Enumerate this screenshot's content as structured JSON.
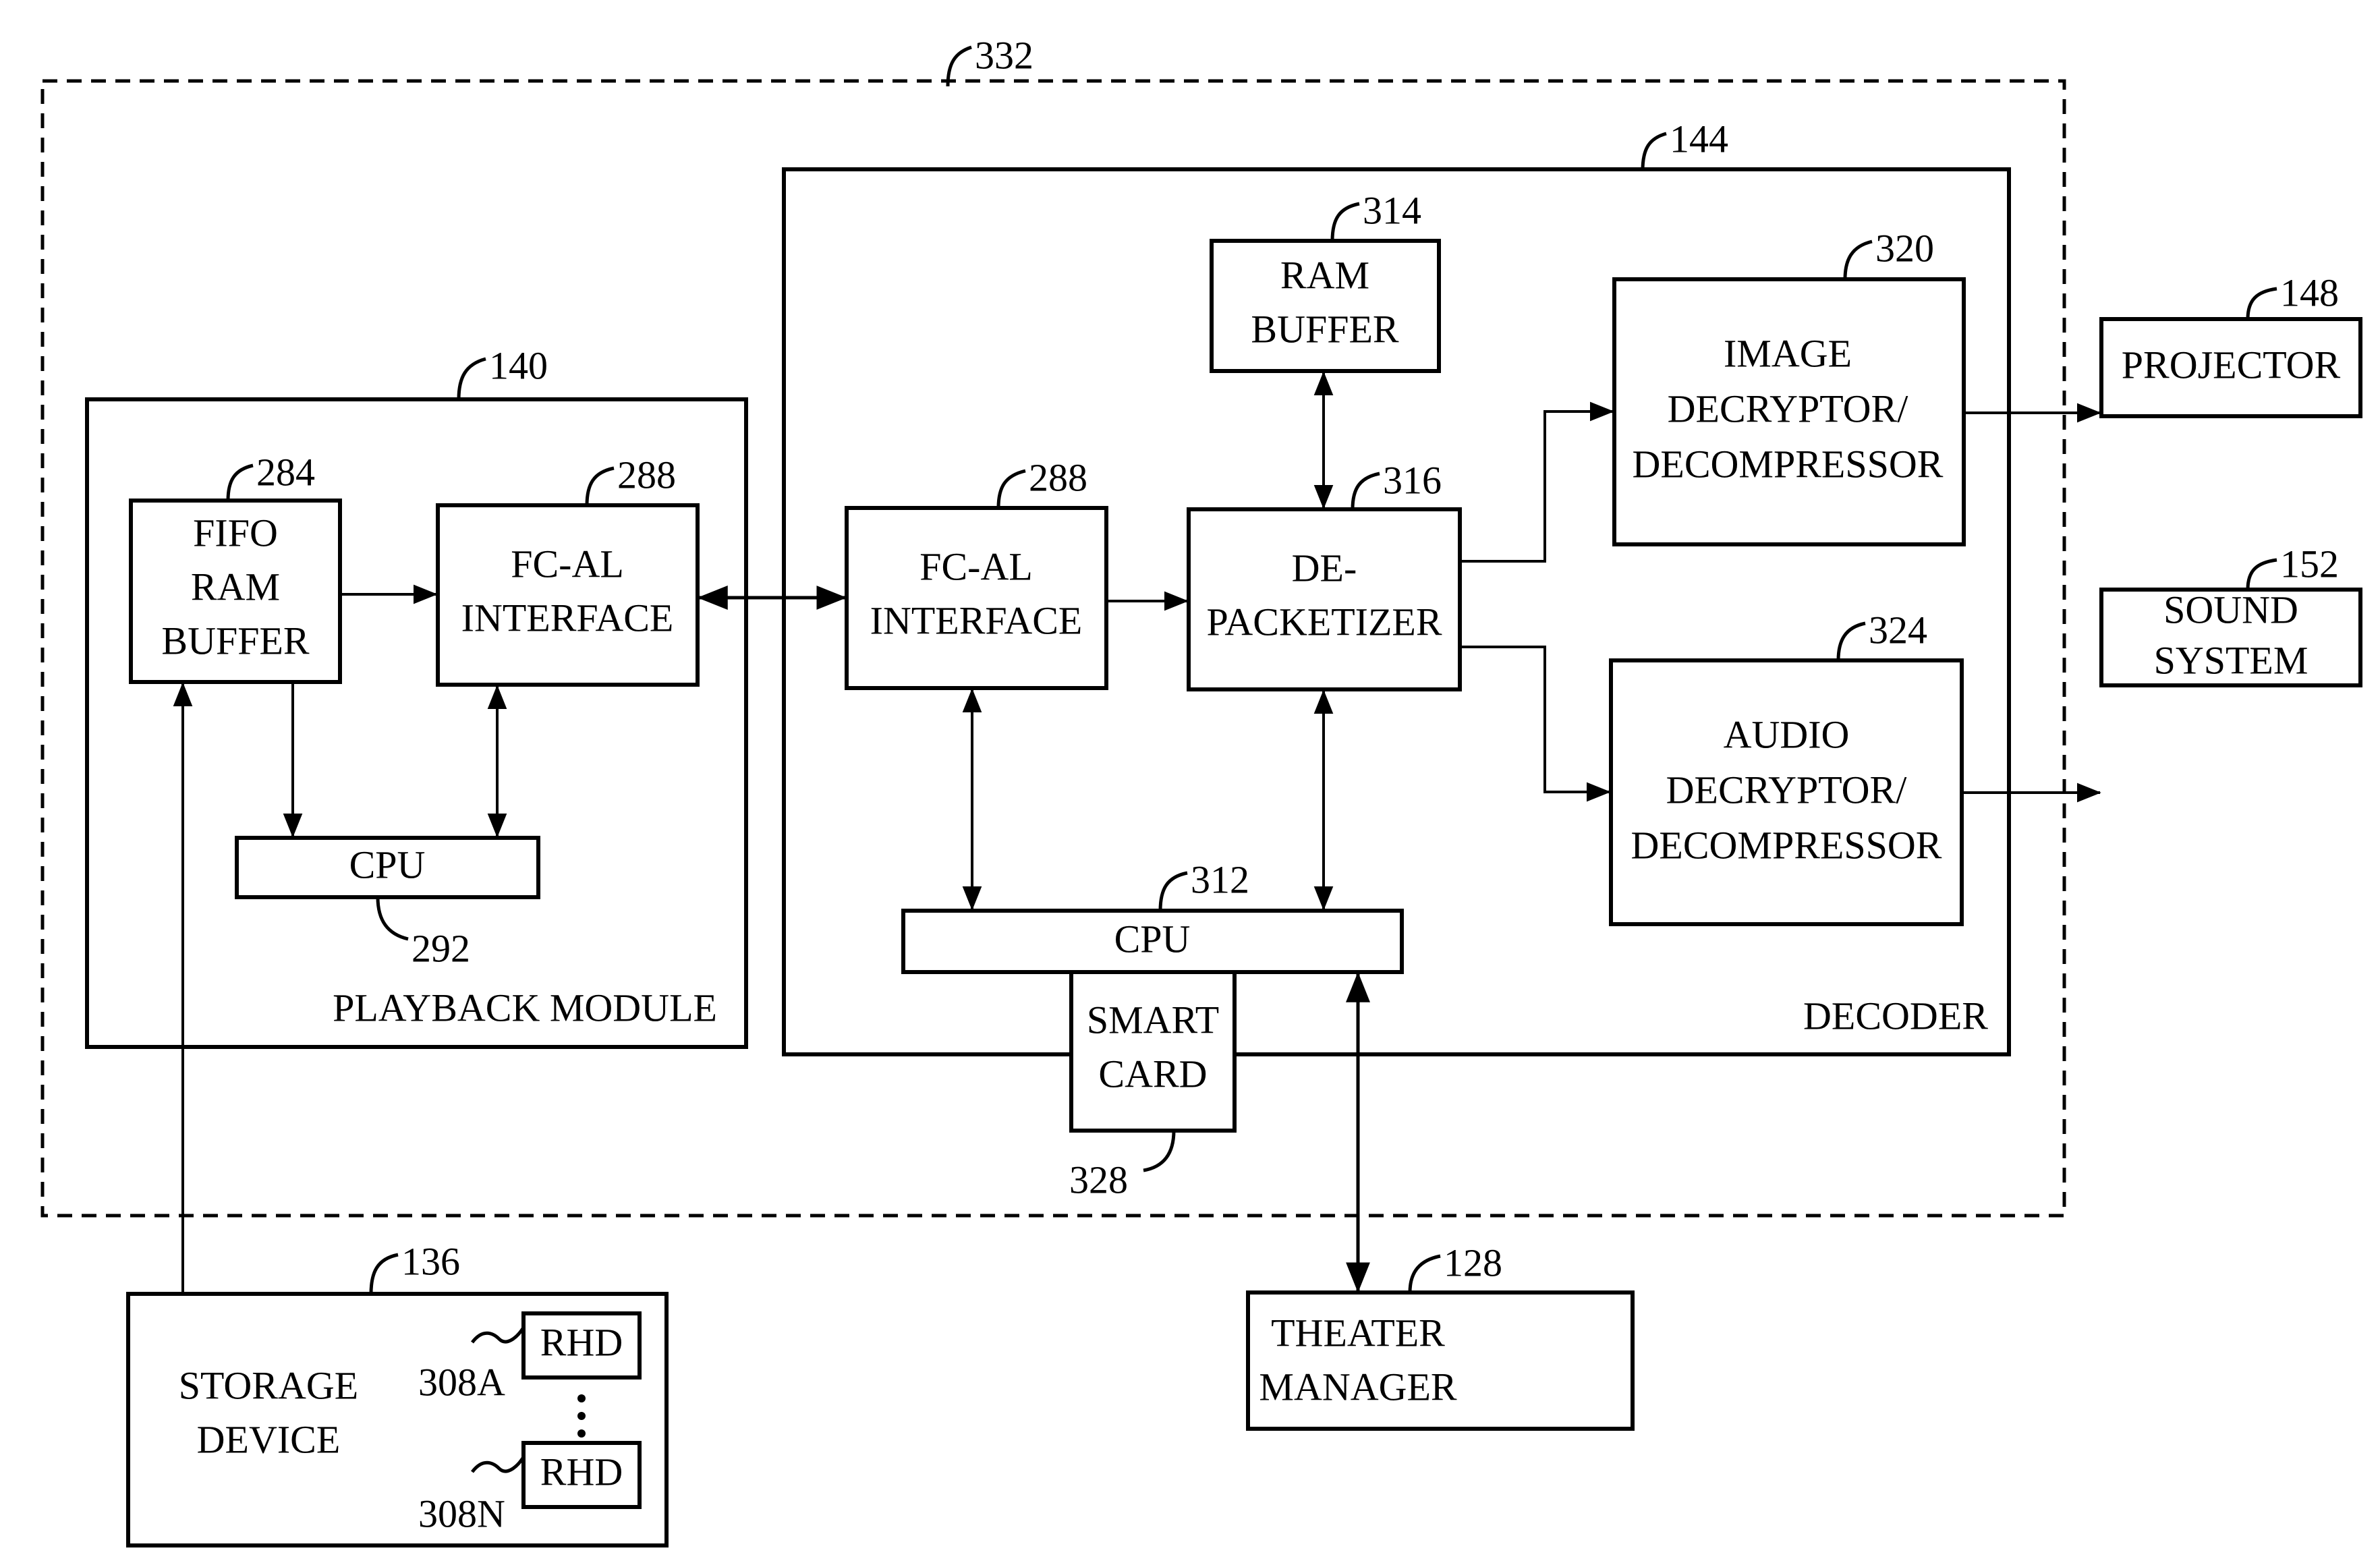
{
  "diagram": {
    "boundary_ref": "332",
    "playback_module": {
      "ref": "140",
      "title": "PLAYBACK MODULE",
      "fifo": {
        "ref": "284",
        "lines": [
          "FIFO",
          "RAM",
          "BUFFER"
        ]
      },
      "fcal": {
        "ref": "288",
        "lines": [
          "FC-AL",
          "INTERFACE"
        ]
      },
      "cpu": {
        "ref": "292",
        "label": "CPU"
      }
    },
    "decoder": {
      "ref": "144",
      "title": "DECODER",
      "ram_buffer": {
        "ref": "314",
        "lines": [
          "RAM",
          "BUFFER"
        ]
      },
      "fcal": {
        "ref": "288",
        "lines": [
          "FC-AL",
          "INTERFACE"
        ]
      },
      "depacketizer": {
        "ref": "316",
        "lines": [
          "DE-",
          "PACKETIZER"
        ]
      },
      "image": {
        "ref": "320",
        "lines": [
          "IMAGE",
          "DECRYPTOR/",
          "DECOMPRESSOR"
        ]
      },
      "audio": {
        "ref": "324",
        "lines": [
          "AUDIO",
          "DECRYPTOR/",
          "DECOMPRESSOR"
        ]
      },
      "cpu": {
        "ref": "312",
        "label": "CPU"
      },
      "smart_card": {
        "ref": "328",
        "lines": [
          "SMART",
          "CARD"
        ]
      }
    },
    "projector": {
      "ref": "148",
      "label": "PROJECTOR"
    },
    "sound_system": {
      "ref": "152",
      "lines": [
        "SOUND",
        "SYSTEM"
      ]
    },
    "storage": {
      "ref": "136",
      "lines": [
        "STORAGE",
        "DEVICE"
      ],
      "rhd_a": {
        "ref": "308A",
        "label": "RHD"
      },
      "rhd_n": {
        "ref": "308N",
        "label": "RHD"
      }
    },
    "theater_manager": {
      "ref": "128",
      "lines": [
        "THEATER",
        "MANAGER"
      ]
    }
  }
}
